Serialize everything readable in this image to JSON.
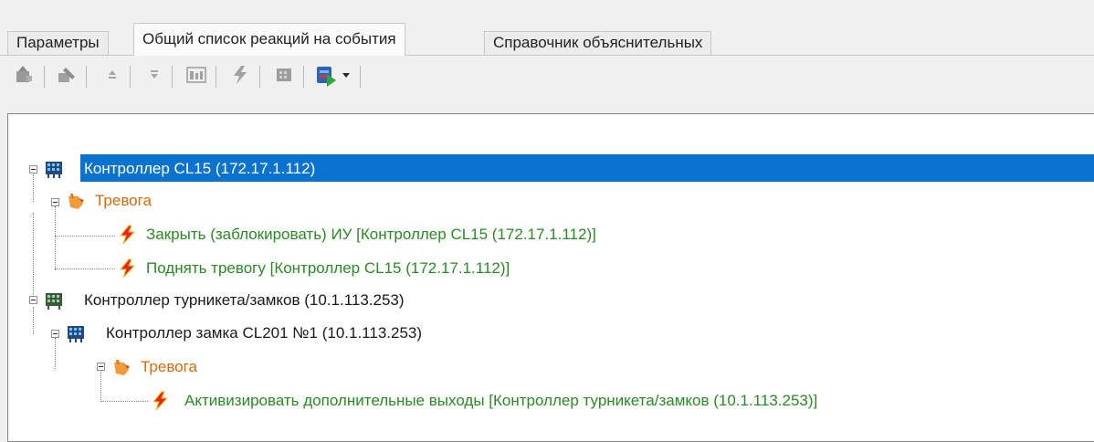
{
  "tabs": [
    {
      "label": "Параметры",
      "active": false
    },
    {
      "label": "Общий список реакций на события",
      "active": true
    },
    {
      "label": "Справочник объяснительных",
      "active": false
    }
  ],
  "toolbar": {
    "buttons": [
      {
        "icon": "add-object-icon",
        "enabled": false
      },
      {
        "icon": "edit-object-icon",
        "enabled": false
      },
      {
        "icon": "move-up-icon",
        "enabled": false
      },
      {
        "icon": "move-down-icon",
        "enabled": false
      },
      {
        "icon": "properties-icon",
        "enabled": false
      },
      {
        "icon": "reaction-icon",
        "enabled": false
      },
      {
        "icon": "device-icon",
        "enabled": false
      },
      {
        "icon": "export-icon",
        "enabled": true,
        "has_dropdown": true
      }
    ]
  },
  "tree": {
    "nodes": [
      {
        "text": "Контроллер CL15 (172.17.1.112)",
        "kind": "controller",
        "selected": true,
        "expanded": true
      },
      {
        "text": "Тревога",
        "kind": "event",
        "expanded": true
      },
      {
        "text": "Закрыть (заблокировать) ИУ [Контроллер CL15 (172.17.1.112)]",
        "kind": "reaction"
      },
      {
        "text": "Поднять тревогу [Контроллер CL15 (172.17.1.112)]",
        "kind": "reaction"
      },
      {
        "text": "Контроллер турникета/замков (10.1.113.253)",
        "kind": "controller",
        "expanded": true
      },
      {
        "text": "Контроллер замка CL201 №1 (10.1.113.253)",
        "kind": "controller",
        "expanded": true
      },
      {
        "text": "Тревога",
        "kind": "event",
        "expanded": true
      },
      {
        "text": "Активизировать дополнительные выходы [Контроллер турникета/замков (10.1.113.253)]",
        "kind": "reaction"
      }
    ]
  },
  "colors": {
    "selection": "#0a73d0",
    "reaction_text": "#2a8a24",
    "event_text": "#d96a0a"
  }
}
